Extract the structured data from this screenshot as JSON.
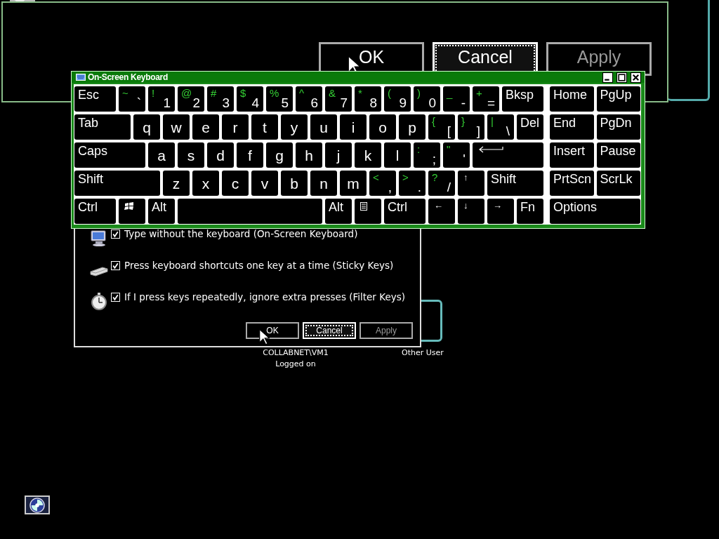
{
  "magnified_dialog": {
    "buttons": [
      {
        "label": "OK",
        "focused": false,
        "disabled": false
      },
      {
        "label": "Cancel",
        "focused": true,
        "disabled": false
      },
      {
        "label": "Apply",
        "focused": false,
        "disabled": true
      }
    ]
  },
  "keyboard": {
    "title": "On-Screen Keyboard",
    "rows": [
      {
        "keys": [
          {
            "kind": "label",
            "text": "Esc"
          },
          {
            "kind": "dual",
            "upper": "~",
            "lower": "`"
          },
          {
            "kind": "dual",
            "upper": "!",
            "lower": "1"
          },
          {
            "kind": "dual",
            "upper": "@",
            "lower": "2"
          },
          {
            "kind": "dual",
            "upper": "#",
            "lower": "3"
          },
          {
            "kind": "dual",
            "upper": "$",
            "lower": "4"
          },
          {
            "kind": "dual",
            "upper": "%",
            "lower": "5"
          },
          {
            "kind": "dual",
            "upper": "^",
            "lower": "6"
          },
          {
            "kind": "dual",
            "upper": "&",
            "lower": "7"
          },
          {
            "kind": "dual",
            "upper": "*",
            "lower": "8"
          },
          {
            "kind": "dual",
            "upper": "(",
            "lower": "9"
          },
          {
            "kind": "dual",
            "upper": ")",
            "lower": "0"
          },
          {
            "kind": "dual",
            "upper": "_",
            "lower": "-"
          },
          {
            "kind": "dual",
            "upper": "+",
            "lower": "="
          },
          {
            "kind": "label",
            "text": "Bksp"
          }
        ],
        "nav": [
          {
            "kind": "label",
            "text": "Home"
          },
          {
            "kind": "label",
            "text": "PgUp"
          }
        ]
      },
      {
        "keys": [
          {
            "kind": "label",
            "text": "Tab"
          },
          {
            "kind": "letter",
            "text": "q"
          },
          {
            "kind": "letter",
            "text": "w"
          },
          {
            "kind": "letter",
            "text": "e"
          },
          {
            "kind": "letter",
            "text": "r"
          },
          {
            "kind": "letter",
            "text": "t"
          },
          {
            "kind": "letter",
            "text": "y"
          },
          {
            "kind": "letter",
            "text": "u"
          },
          {
            "kind": "letter",
            "text": "i"
          },
          {
            "kind": "letter",
            "text": "o"
          },
          {
            "kind": "letter",
            "text": "p"
          },
          {
            "kind": "dual",
            "upper": "{",
            "lower": "["
          },
          {
            "kind": "dual",
            "upper": "}",
            "lower": "]"
          },
          {
            "kind": "dual",
            "upper": "|",
            "lower": "\\"
          },
          {
            "kind": "label",
            "text": "Del"
          }
        ],
        "nav": [
          {
            "kind": "label",
            "text": "End"
          },
          {
            "kind": "label",
            "text": "PgDn"
          }
        ]
      },
      {
        "keys": [
          {
            "kind": "label",
            "text": "Caps"
          },
          {
            "kind": "letter",
            "text": "a"
          },
          {
            "kind": "letter",
            "text": "s"
          },
          {
            "kind": "letter",
            "text": "d"
          },
          {
            "kind": "letter",
            "text": "f"
          },
          {
            "kind": "letter",
            "text": "g"
          },
          {
            "kind": "letter",
            "text": "h"
          },
          {
            "kind": "letter",
            "text": "j"
          },
          {
            "kind": "letter",
            "text": "k"
          },
          {
            "kind": "letter",
            "text": "l"
          },
          {
            "kind": "dual",
            "upper": ":",
            "lower": ";"
          },
          {
            "kind": "dual",
            "upper": "\"",
            "lower": "'"
          },
          {
            "kind": "enter"
          }
        ],
        "nav": [
          {
            "kind": "label",
            "text": "Insert"
          },
          {
            "kind": "label",
            "text": "Pause"
          }
        ]
      },
      {
        "keys": [
          {
            "kind": "label",
            "text": "Shift"
          },
          {
            "kind": "letter",
            "text": "z"
          },
          {
            "kind": "letter",
            "text": "x"
          },
          {
            "kind": "letter",
            "text": "c"
          },
          {
            "kind": "letter",
            "text": "v"
          },
          {
            "kind": "letter",
            "text": "b"
          },
          {
            "kind": "letter",
            "text": "n"
          },
          {
            "kind": "letter",
            "text": "m"
          },
          {
            "kind": "dual",
            "upper": "<",
            "lower": ","
          },
          {
            "kind": "dual",
            "upper": ">",
            "lower": "."
          },
          {
            "kind": "dual",
            "upper": "?",
            "lower": "/"
          },
          {
            "kind": "arrow",
            "text": "↑"
          },
          {
            "kind": "label",
            "text": "Shift"
          }
        ],
        "nav": [
          {
            "kind": "label",
            "text": "PrtScn"
          },
          {
            "kind": "label",
            "text": "ScrLk"
          }
        ]
      },
      {
        "keys": [
          {
            "kind": "label",
            "text": "Ctrl"
          },
          {
            "kind": "windows"
          },
          {
            "kind": "label",
            "text": "Alt"
          },
          {
            "kind": "space"
          },
          {
            "kind": "label",
            "text": "Alt"
          },
          {
            "kind": "menu"
          },
          {
            "kind": "label",
            "text": "Ctrl"
          },
          {
            "kind": "arrow",
            "text": "←"
          },
          {
            "kind": "arrow",
            "text": "↓"
          },
          {
            "kind": "arrow",
            "text": "→"
          },
          {
            "kind": "label",
            "text": "Fn"
          }
        ],
        "nav": [
          {
            "kind": "label",
            "text": "Options"
          }
        ]
      }
    ]
  },
  "dialog": {
    "options": [
      {
        "kind": "monitor",
        "text": "Type without the keyboard (On-Screen Keyboard)",
        "checked": true
      },
      {
        "kind": "keyboard",
        "text": "Press keyboard shortcuts one key at a time (Sticky Keys)",
        "checked": true
      },
      {
        "kind": "stopwatch",
        "text": "If I press keys repeatedly, ignore extra presses (Filter Keys)",
        "checked": true
      }
    ],
    "buttons": [
      {
        "label": "OK",
        "focused": false,
        "disabled": false
      },
      {
        "label": "Cancel",
        "focused": true,
        "disabled": false
      },
      {
        "label": "Apply",
        "focused": false,
        "disabled": true
      }
    ]
  },
  "users": [
    {
      "name": "COLLABNET\\VM1",
      "status": "Logged on"
    },
    {
      "name": "Other User"
    }
  ]
}
